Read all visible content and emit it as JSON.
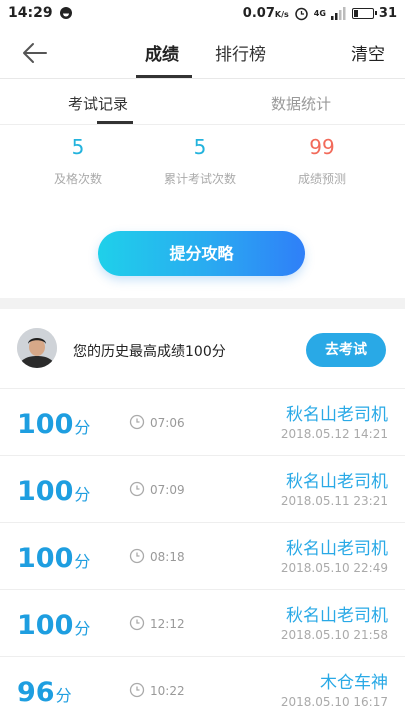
{
  "status_bar": {
    "time": "14:29",
    "speed": "0.07",
    "speed_unit": "K/s",
    "network": "4G",
    "battery": "31"
  },
  "nav": {
    "tabs": [
      {
        "label": "成绩",
        "active": true
      },
      {
        "label": "排行榜",
        "active": false
      }
    ],
    "clear_label": "清空"
  },
  "subtabs": [
    {
      "label": "考试记录",
      "active": true
    },
    {
      "label": "数据统计",
      "active": false
    }
  ],
  "stats": [
    {
      "value": "5",
      "label": "及格次数"
    },
    {
      "value": "5",
      "label": "累计考试次数"
    },
    {
      "value": "99",
      "label": "成绩预测"
    }
  ],
  "cta_label": "提分攻略",
  "best": {
    "text": "您的历史最高成绩100分",
    "button_label": "去考试"
  },
  "records": [
    {
      "score": "100",
      "unit": "分",
      "duration": "07:06",
      "name": "秋名山老司机",
      "date": "2018.05.12  14:21"
    },
    {
      "score": "100",
      "unit": "分",
      "duration": "07:09",
      "name": "秋名山老司机",
      "date": "2018.05.11  23:21"
    },
    {
      "score": "100",
      "unit": "分",
      "duration": "08:18",
      "name": "秋名山老司机",
      "date": "2018.05.10  22:49"
    },
    {
      "score": "100",
      "unit": "分",
      "duration": "12:12",
      "name": "秋名山老司机",
      "date": "2018.05.10  21:58"
    },
    {
      "score": "96",
      "unit": "分",
      "duration": "10:22",
      "name": "木仓车神",
      "date": "2018.05.10  16:17"
    }
  ],
  "colors": {
    "accent": "#29a9e6",
    "score_blue": "#1e9ee0",
    "prediction_red": "#f26a5a"
  }
}
